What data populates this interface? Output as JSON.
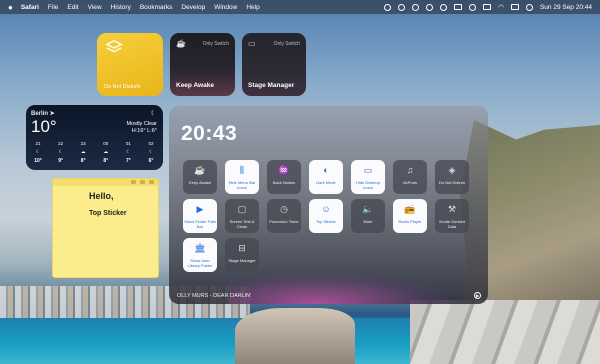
{
  "menubar": {
    "apple": "",
    "app": "Safari",
    "menus": [
      "File",
      "Edit",
      "View",
      "History",
      "Bookmarks",
      "Develop",
      "Window",
      "Help"
    ],
    "clock": "Sun 29 Sep  20:44"
  },
  "widgets": {
    "dnd": {
      "label": "Do Not Disturb"
    },
    "keep_awake": {
      "top": "Only Switch",
      "label": "Keep Awake"
    },
    "stage_manager": {
      "top": "Only Switch",
      "label": "Stage Manager"
    }
  },
  "weather": {
    "city": "Berlin ➤",
    "temp": "10°",
    "condition": "Mostly Clear",
    "range": "H:16° L:6°",
    "hours": [
      {
        "h": "21",
        "icon": "☾",
        "t": "10°"
      },
      {
        "h": "22",
        "icon": "☾",
        "t": "9°"
      },
      {
        "h": "23",
        "icon": "☁",
        "t": "8°"
      },
      {
        "h": "00",
        "icon": "☁",
        "t": "8°"
      },
      {
        "h": "01",
        "icon": "☾",
        "t": "7°"
      },
      {
        "h": "02",
        "icon": "☾",
        "t": "6°"
      }
    ]
  },
  "sticky": {
    "line1": "Hello,",
    "line2": "Top Sticker"
  },
  "panel": {
    "clock": "20:43",
    "now_playing": "OLLY MURS - DEAR DARLIN'",
    "tiles": [
      {
        "label": "Keep Awake",
        "icon": "☕",
        "on": false
      },
      {
        "label": "Hide Menu Bar Icons",
        "icon": "⫼",
        "on": true
      },
      {
        "label": "Back Noises",
        "icon": "♒",
        "on": false
      },
      {
        "label": "Dark Mode",
        "icon": "◐",
        "on": true
      },
      {
        "label": "Hide Desktop Icons",
        "icon": "▭",
        "on": true
      },
      {
        "label": "AirPods",
        "icon": "♫",
        "on": false
      },
      {
        "label": "Do Not Disturb",
        "icon": "◈",
        "on": false
      },
      {
        "label": "Show Finder Path Bar",
        "icon": "▶",
        "on": true
      },
      {
        "label": "Screen Test & Clean",
        "icon": "▢",
        "on": false
      },
      {
        "label": "Pomodoro Timer",
        "icon": "◷",
        "on": false
      },
      {
        "label": "Top Sticker",
        "icon": "☺",
        "on": true
      },
      {
        "label": "Mute",
        "icon": "🔈",
        "on": false
      },
      {
        "label": "Radio Player",
        "icon": "📻",
        "on": true
      },
      {
        "label": "Xcode Derived Data",
        "icon": "⚒",
        "on": false
      },
      {
        "label": "Show User Library Folder",
        "icon": "🏛",
        "on": true
      },
      {
        "label": "Stage Manager",
        "icon": "⊟",
        "on": false
      }
    ]
  },
  "colors": {
    "accent": "#1d6de0",
    "sticky": "#fbec8c",
    "dnd": "#f2c32f"
  }
}
